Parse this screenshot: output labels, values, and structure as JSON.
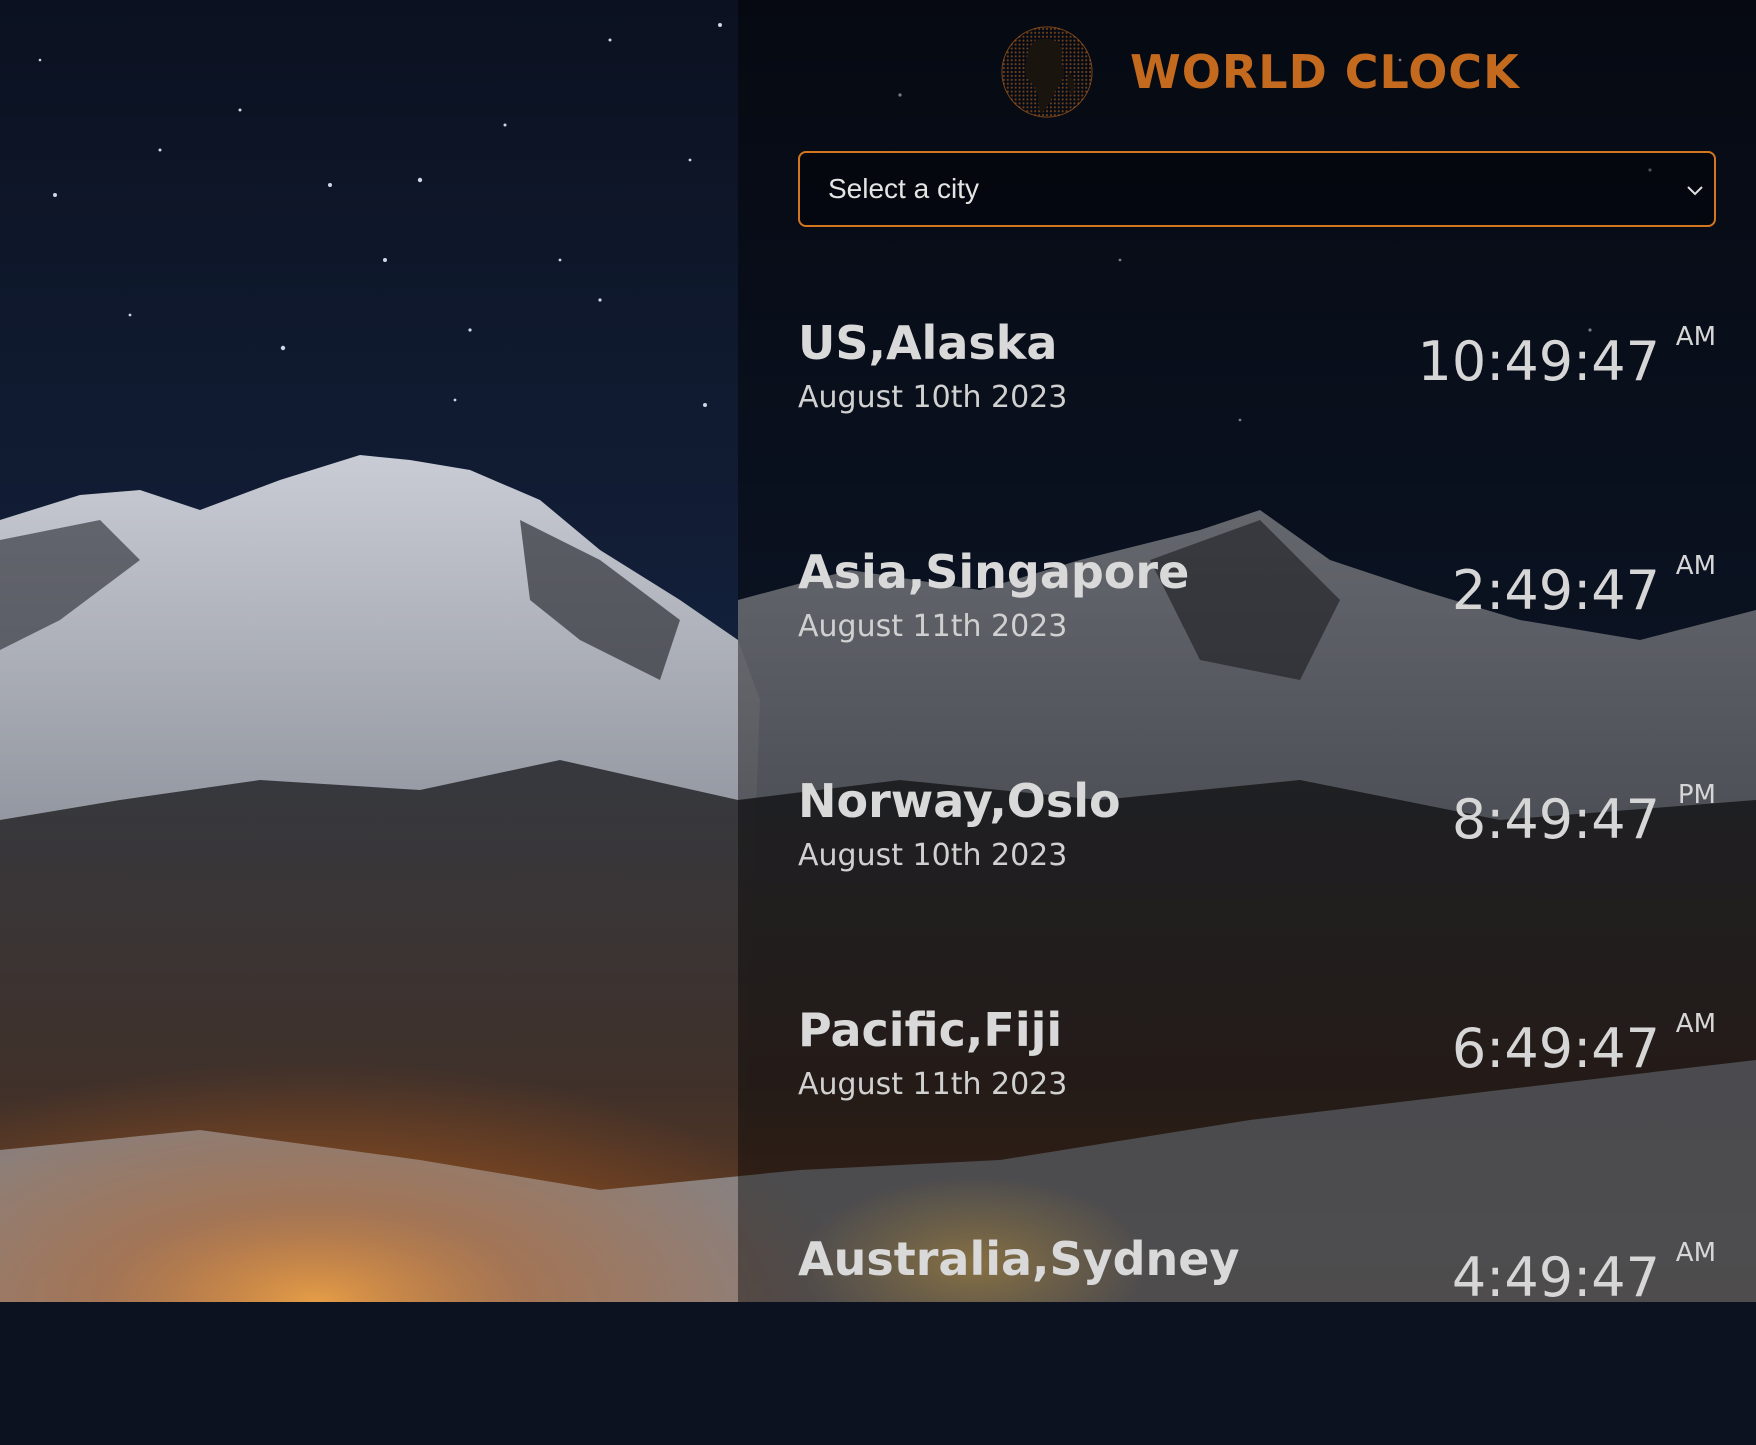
{
  "header": {
    "title": "WORLD CLOCK",
    "logo_icon": "globe-icon",
    "accent_color": "#c46a1e"
  },
  "city_select": {
    "selected": "Select a city",
    "icon": "chevron-down-icon"
  },
  "clocks": [
    {
      "city": "US,Alaska",
      "date": "August 10th 2023",
      "time": "10:49:47",
      "ampm": "AM"
    },
    {
      "city": "Asia,Singapore",
      "date": "August 11th 2023",
      "time": "2:49:47",
      "ampm": "AM"
    },
    {
      "city": "Norway,Oslo",
      "date": "August 10th 2023",
      "time": "8:49:47",
      "ampm": "PM"
    },
    {
      "city": "Pacific,Fiji",
      "date": "August 11th 2023",
      "time": "6:49:47",
      "ampm": "AM"
    },
    {
      "city": "Australia,Sydney",
      "date": "",
      "time": "4:49:47",
      "ampm": "AM"
    }
  ]
}
